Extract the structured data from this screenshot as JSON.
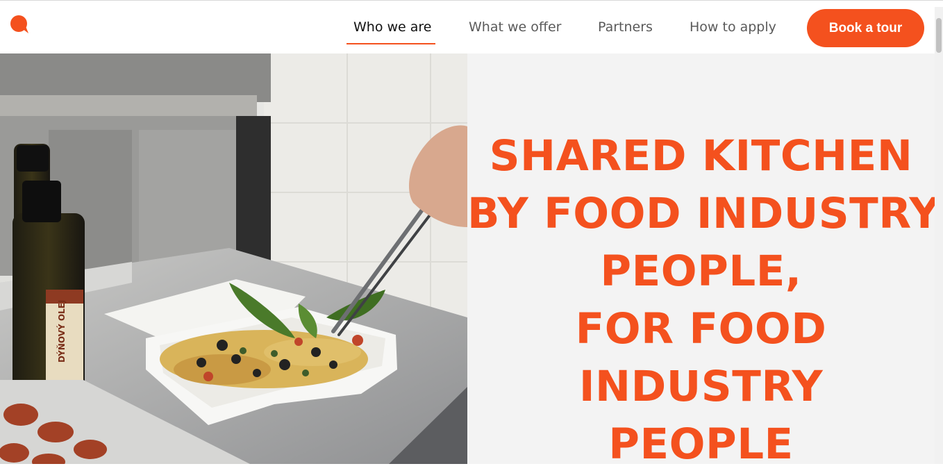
{
  "brand": {
    "logo_icon": "speech-bubble-logo-icon",
    "accent_color": "#f4511e"
  },
  "nav": {
    "items": [
      {
        "label": "Who we are",
        "active": true
      },
      {
        "label": "What we offer",
        "active": false
      },
      {
        "label": "Partners",
        "active": false
      },
      {
        "label": "How to apply",
        "active": false
      }
    ],
    "cta_label": "Book a tour"
  },
  "hero": {
    "headline_lines": [
      "SHARED KITCHEN",
      "BY FOOD INDUSTRY",
      "PEOPLE,",
      "FOR FOOD",
      "INDUSTRY",
      "PEOPLE"
    ],
    "image": {
      "subject": "chef-plating-pasta-photo",
      "bottle_label": "DÝŇOVÝ OLEJ"
    }
  }
}
